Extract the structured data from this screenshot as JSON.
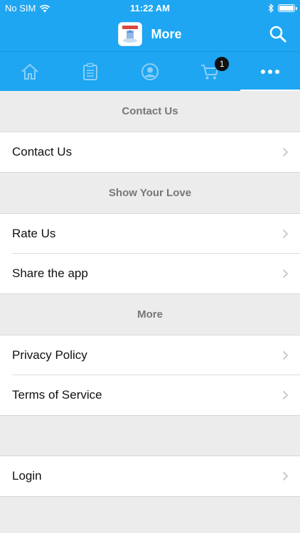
{
  "status_bar": {
    "carrier": "No SIM",
    "time": "11:22 AM"
  },
  "header": {
    "title": "More"
  },
  "tabs": [
    {
      "name": "home"
    },
    {
      "name": "orders"
    },
    {
      "name": "account"
    },
    {
      "name": "cart",
      "badge": "1"
    },
    {
      "name": "more",
      "active": true
    }
  ],
  "sections": {
    "contact": {
      "title": "Contact Us",
      "items": [
        "Contact Us"
      ]
    },
    "love": {
      "title": "Show Your Love",
      "items": [
        "Rate Us",
        "Share the app"
      ]
    },
    "more": {
      "title": "More",
      "items": [
        "Privacy Policy",
        "Terms of Service"
      ]
    },
    "account": {
      "items": [
        "Login"
      ]
    }
  },
  "colors": {
    "brand": "#1ea6f3",
    "background": "#ececec",
    "section_text": "#777777"
  }
}
